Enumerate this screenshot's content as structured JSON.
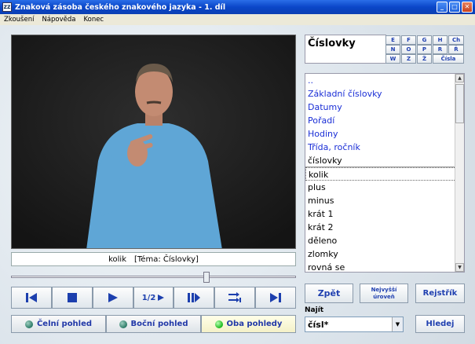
{
  "window": {
    "title": "Znaková zásoba českého znakového jazyka  - 1. díl",
    "icon_text": "ZZ"
  },
  "menu": [
    "Zkoušení",
    "Nápověda",
    "Konec"
  ],
  "caption": {
    "word": "kolik",
    "topic": "[Téma: Číslovky]"
  },
  "slider": {
    "position": 0.69
  },
  "controls": {
    "speed_label": "1/2"
  },
  "views": [
    {
      "label": "Čelní pohled",
      "active": false
    },
    {
      "label": "Boční pohled",
      "active": false
    },
    {
      "label": "Oba pohledy",
      "active": true
    }
  ],
  "topic_title": "Číslovky",
  "letters": [
    "E",
    "F",
    "G",
    "H",
    "Ch",
    "N",
    "O",
    "P",
    "R",
    "Ř",
    "W",
    "Z",
    "Ž",
    "Čísla"
  ],
  "list_items": [
    {
      "text": "..",
      "type": "nav"
    },
    {
      "text": "Základní číslovky",
      "type": "nav"
    },
    {
      "text": "Datumy",
      "type": "nav"
    },
    {
      "text": "Pořadí",
      "type": "nav"
    },
    {
      "text": "Hodiny",
      "type": "nav"
    },
    {
      "text": "Třída, ročník",
      "type": "nav"
    },
    {
      "text": "číslovky",
      "type": "sep"
    },
    {
      "text": "kolik",
      "type": "sel"
    },
    {
      "text": "plus",
      "type": "item"
    },
    {
      "text": "minus",
      "type": "item"
    },
    {
      "text": "krát 1",
      "type": "item"
    },
    {
      "text": "krát 2",
      "type": "item"
    },
    {
      "text": "děleno",
      "type": "item"
    },
    {
      "text": "zlomky",
      "type": "item"
    },
    {
      "text": "rovná se",
      "type": "item"
    }
  ],
  "buttons": {
    "back": "Zpět",
    "top_level": "Nejvyšší úroveň",
    "index": "Rejstřík",
    "search": "Hledej"
  },
  "find": {
    "label": "Najít",
    "value": "čísl*"
  },
  "colors": {
    "accent": "#2040b0",
    "nav_link": "#1a2ed6",
    "led_on": "#19b81b"
  }
}
